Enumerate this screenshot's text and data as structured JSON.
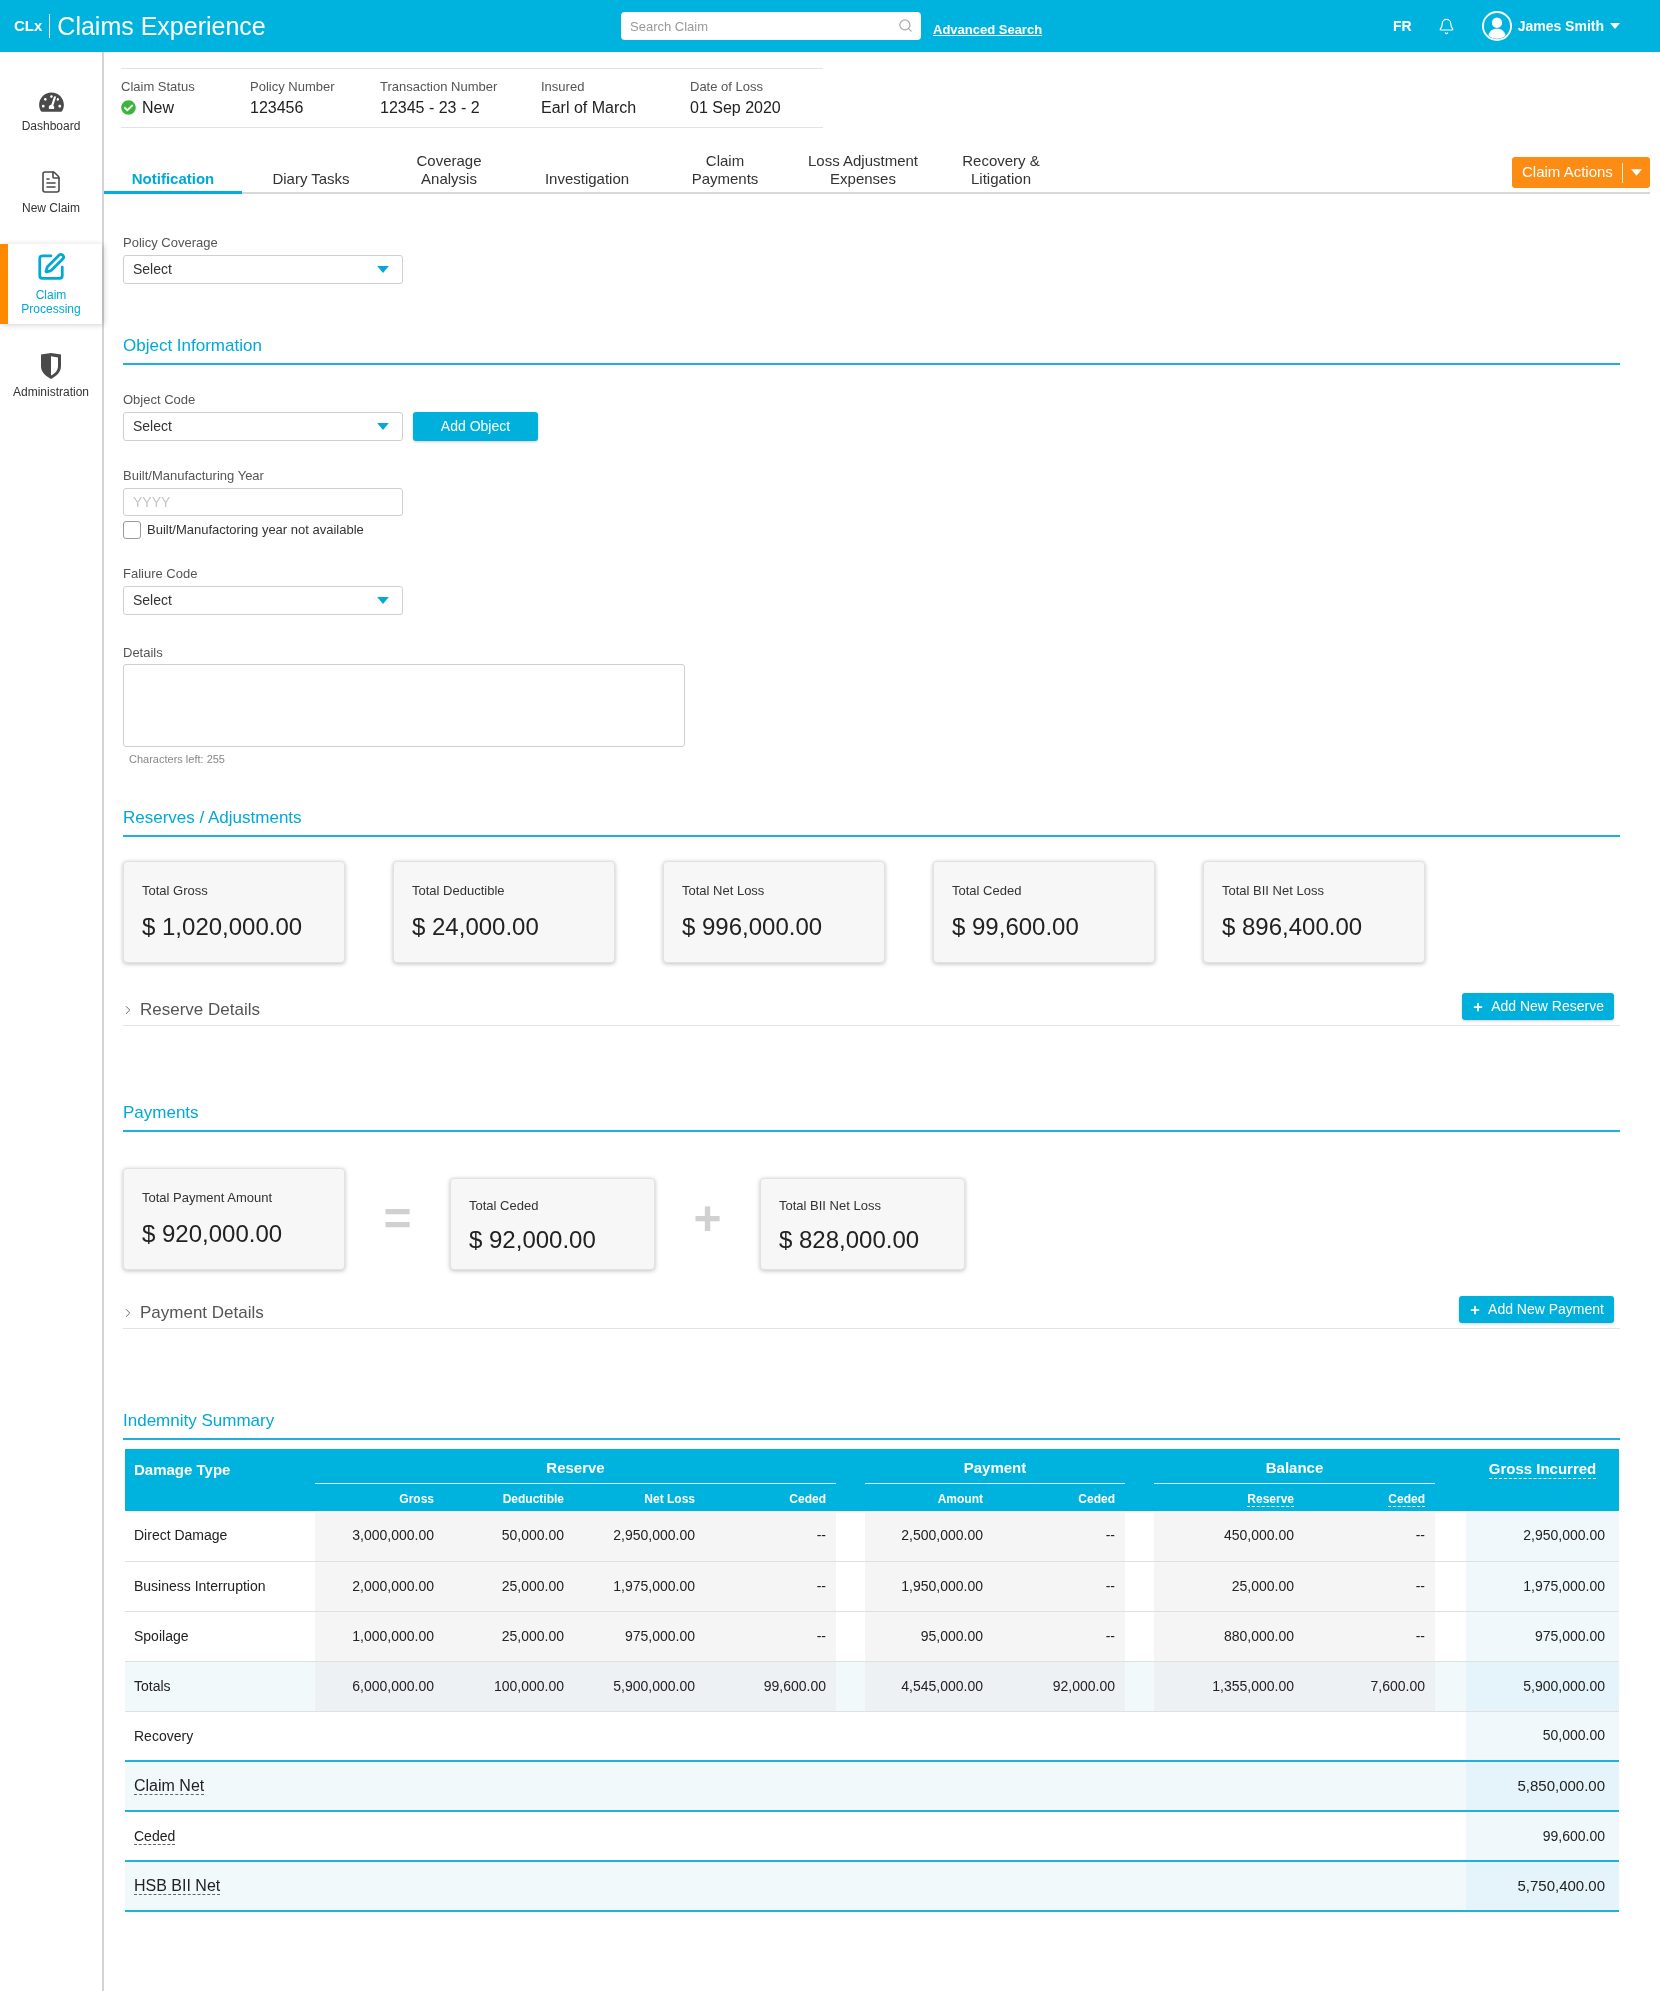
{
  "top_bar": {
    "logo": "CLx",
    "title": "Claims Experience",
    "search": {
      "placeholder": "Search Claim"
    },
    "advanced_search": "Advanced Search",
    "language": "FR",
    "user": "James Smith"
  },
  "sidebar": {
    "items": [
      {
        "label": "Dashboard",
        "selected": false
      },
      {
        "label": "New Claim",
        "selected": false
      },
      {
        "label": "Claim Processing",
        "selected": true
      },
      {
        "label": "Administration",
        "selected": false
      }
    ]
  },
  "claim_header": [
    {
      "kind": "status",
      "label": "Claim Status",
      "value": "New"
    },
    {
      "kind": "text",
      "label": "Policy Number",
      "value": "123456"
    },
    {
      "kind": "text",
      "label": "Transaction Number",
      "value": "12345 - 23 - 2"
    },
    {
      "kind": "text",
      "label": "Insured",
      "value": "Earl of March"
    },
    {
      "kind": "text",
      "label": "Date of Loss",
      "value": "01 Sep 2020"
    }
  ],
  "tabs": [
    {
      "lines": [
        "Notification"
      ],
      "selected": true
    },
    {
      "lines": [
        "Diary Tasks"
      ],
      "selected": false
    },
    {
      "lines": [
        "Coverage",
        "Analysis"
      ],
      "selected": false
    },
    {
      "lines": [
        "Investigation"
      ],
      "selected": false
    },
    {
      "lines": [
        "Claim",
        "Payments"
      ],
      "selected": false
    },
    {
      "lines": [
        "Loss Adjustment",
        "Expenses"
      ],
      "selected": false
    },
    {
      "lines": [
        "Recovery &",
        "Litigation"
      ],
      "selected": false
    }
  ],
  "claim_actions": {
    "label": "Claim Actions"
  },
  "policy_coverage": {
    "label": "Policy Coverage",
    "value": "Select"
  },
  "object_information": {
    "title": "Object Information",
    "fields": [
      {
        "kind": "select",
        "label": "Object Code",
        "value": "Select",
        "button": "Add Object"
      },
      {
        "kind": "year",
        "label": "Built/Manufacturing Year",
        "placeholder": "YYYY",
        "checkbox": {
          "label": "Built/Manufactoring year not available",
          "checked": false
        }
      },
      {
        "kind": "select",
        "label": "Faliure Code",
        "value": "Select"
      },
      {
        "kind": "textarea",
        "label": "Details",
        "counter": "Characters left: 255"
      }
    ]
  },
  "reserves": {
    "title": "Reserves / Adjustments",
    "cards": [
      {
        "label": "Total Gross",
        "amount": "$ 1,020,000.00"
      },
      {
        "label": "Total Deductible",
        "amount": "$ 24,000.00"
      },
      {
        "label": "Total Net Loss",
        "amount": "$ 996,000.00"
      },
      {
        "label": "Total Ceded",
        "amount": "$ 99,600.00"
      },
      {
        "label": "Total BII Net Loss",
        "amount": "$ 896,400.00"
      }
    ],
    "details": {
      "label": "Reserve Details",
      "expanded": false
    },
    "add_button": "Add New Reserve"
  },
  "payments": {
    "title": "Payments",
    "items": [
      {
        "kind": "result",
        "label": "Total Payment Amount",
        "amount": "$ 920,000.00"
      },
      {
        "kind": "operator",
        "symbol": "="
      },
      {
        "kind": "term",
        "label": "Total Ceded",
        "amount": "$ 92,000.00"
      },
      {
        "kind": "operator",
        "symbol": "+"
      },
      {
        "kind": "term",
        "label": "Total BII Net Loss",
        "amount": "$ 828,000.00"
      }
    ],
    "details": {
      "label": "Payment Details",
      "expanded": false
    },
    "add_button": "Add New Payment"
  },
  "indemnity_summary": {
    "title": "Indemnity Summary",
    "first_column": "Damage Type",
    "groups": [
      {
        "label": "Reserve",
        "columns": [
          {
            "label": "Gross",
            "underlined": false
          },
          {
            "label": "Deductible",
            "underlined": false
          },
          {
            "label": "Net Loss",
            "underlined": false
          },
          {
            "label": "Ceded",
            "underlined": false
          }
        ]
      },
      {
        "label": "Payment",
        "columns": [
          {
            "label": "Amount",
            "underlined": false
          },
          {
            "label": "Ceded",
            "underlined": false
          }
        ]
      },
      {
        "label": "Balance",
        "columns": [
          {
            "label": "Reserve",
            "underlined": true
          },
          {
            "label": "Ceded",
            "underlined": true
          }
        ]
      }
    ],
    "last_column": {
      "label": "Gross Incurred",
      "underlined": true
    },
    "rows": [
      {
        "kind": "detail",
        "cells": [
          "Direct Damage",
          "3,000,000.00",
          "50,000.00",
          "2,950,000.00",
          "--",
          "2,500,000.00",
          "--",
          "450,000.00",
          "--",
          "2,950,000.00"
        ]
      },
      {
        "kind": "detail",
        "cells": [
          "Business Interruption",
          "2,000,000.00",
          "25,000.00",
          "1,975,000.00",
          "--",
          "1,950,000.00",
          "--",
          "25,000.00",
          "--",
          "1,975,000.00"
        ]
      },
      {
        "kind": "detail",
        "cells": [
          "Spoilage",
          "1,000,000.00",
          "25,000.00",
          "975,000.00",
          "--",
          "95,000.00",
          "--",
          "880,000.00",
          "--",
          "975,000.00"
        ]
      },
      {
        "kind": "total",
        "cells": [
          "Totals",
          "6,000,000.00",
          "100,000.00",
          "5,900,000.00",
          "99,600.00",
          "4,545,000.00",
          "92,000.00",
          "1,355,000.00",
          "7,600.00",
          "5,900,000.00"
        ]
      },
      {
        "kind": "summary",
        "label": "Recovery",
        "underlined": false,
        "value": "50,000.00"
      },
      {
        "kind": "net",
        "label": "Claim Net",
        "underlined": true,
        "value": "5,850,000.00"
      },
      {
        "kind": "summary",
        "label": "Ceded",
        "underlined": true,
        "value": "99,600.00"
      },
      {
        "kind": "net",
        "label": "HSB BII Net",
        "underlined": true,
        "value": "5,750,400.00"
      }
    ]
  }
}
